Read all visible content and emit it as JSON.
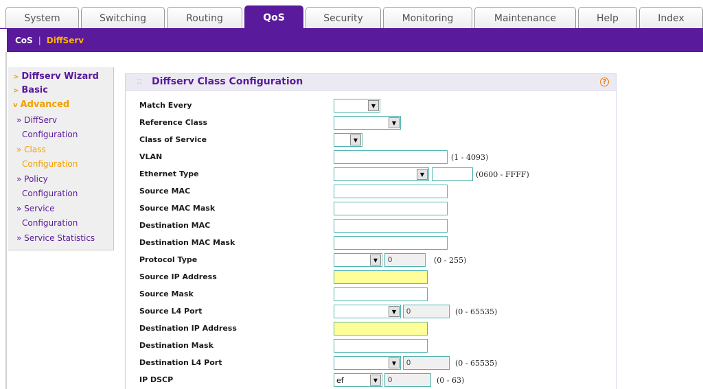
{
  "tabs": [
    {
      "label": "System"
    },
    {
      "label": "Switching"
    },
    {
      "label": "Routing"
    },
    {
      "label": "QoS"
    },
    {
      "label": "Security"
    },
    {
      "label": "Monitoring"
    },
    {
      "label": "Maintenance"
    },
    {
      "label": "Help"
    },
    {
      "label": "Index"
    }
  ],
  "active_tab": "QoS",
  "subnav": {
    "cos": "CoS",
    "separator": "|",
    "diffserv": "DiffServ"
  },
  "sidebar": {
    "wizard": "Diffserv Wizard",
    "basic": "Basic",
    "advanced": "Advanced",
    "items": [
      {
        "line1": "» DiffServ",
        "line2": "Configuration"
      },
      {
        "line1": "» Class",
        "line2": "Configuration"
      },
      {
        "line1": "» Policy",
        "line2": "Configuration"
      },
      {
        "line1": "» Service",
        "line2": "Configuration"
      },
      {
        "line1": "» Service Statistics",
        "line2": ""
      }
    ]
  },
  "panel": {
    "title": "Diffserv Class Configuration",
    "help": "?"
  },
  "form": {
    "match_every": {
      "label": "Match Every",
      "value": ""
    },
    "reference_class": {
      "label": "Reference Class",
      "value": ""
    },
    "class_of_service": {
      "label": "Class of Service",
      "value": ""
    },
    "vlan": {
      "label": "VLAN",
      "value": "",
      "range": "(1 - 4093)"
    },
    "ethernet_type": {
      "label": "Ethernet Type",
      "value": "",
      "text": "",
      "range": "(0600 - FFFF)"
    },
    "source_mac": {
      "label": "Source MAC",
      "value": ""
    },
    "source_mac_mask": {
      "label": "Source MAC Mask",
      "value": ""
    },
    "destination_mac": {
      "label": "Destination MAC",
      "value": ""
    },
    "destination_mac_mask": {
      "label": "Destination MAC Mask",
      "value": ""
    },
    "protocol_type": {
      "label": "Protocol Type",
      "value": "",
      "number": "0",
      "range": "(0 - 255)"
    },
    "source_ip_address": {
      "label": "Source IP Address",
      "value": ""
    },
    "source_mask": {
      "label": "Source Mask",
      "value": ""
    },
    "source_l4_port": {
      "label": "Source L4 Port",
      "value": "",
      "number": "0",
      "range": "(0 - 65535)"
    },
    "destination_ip_address": {
      "label": "Destination IP Address",
      "value": ""
    },
    "destination_mask": {
      "label": "Destination Mask",
      "value": ""
    },
    "destination_l4_port": {
      "label": "Destination L4 Port",
      "value": "",
      "number": "0",
      "range": "(0 - 65535)"
    },
    "ip_dscp": {
      "label": "IP DSCP",
      "value": "ef",
      "number": "0",
      "range": "(0 - 63)"
    }
  },
  "colors": {
    "brand_purple": "#5a1a9c",
    "accent_orange": "#f0a000",
    "field_border": "#4fb3ae",
    "highlight_yellow": "#ffff99"
  }
}
